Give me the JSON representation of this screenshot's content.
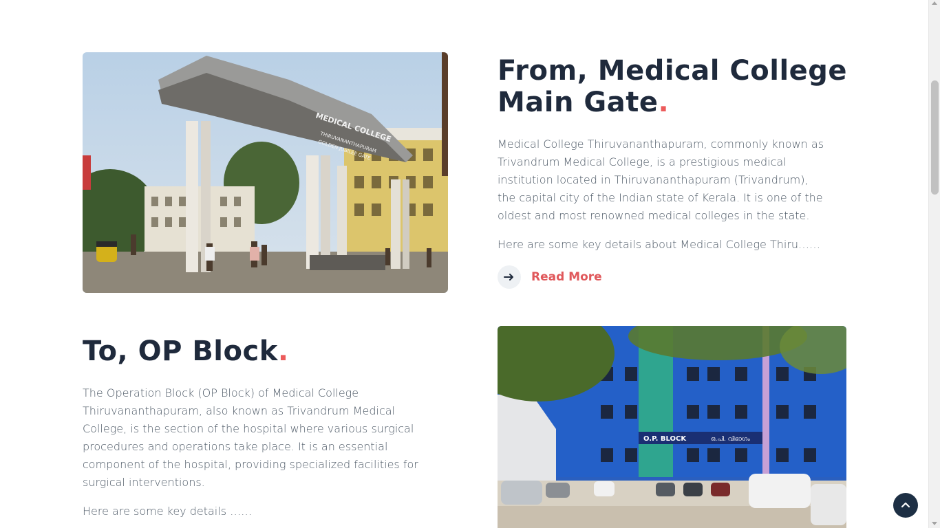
{
  "section_gate": {
    "title": "From, Medical College Main Gate",
    "title_dot": ".",
    "image_alt": "Medical College main gate arch",
    "paragraph": "Medical College Thiruvananthapuram, commonly known as Trivandrum Medical College, is a prestigious medical institution located in Thiruvananthapuram (Trivandrum), the capital city of the Indian state of Kerala. It is one of the oldest and most renowned medical colleges in the state.",
    "excerpt": "Here are some key details about Medical College Thiru……",
    "read_more_label": "Read More",
    "sign_text_1": "MEDICAL COLLEGE",
    "sign_text_2": "THIRUVANANTHAPURAM",
    "sign_text_3": "GOLDEN JUBILEE GATE"
  },
  "section_op": {
    "title": "To, OP Block",
    "title_dot": ".",
    "image_alt": "O.P. Block building",
    "paragraph": "The Operation Block (OP Block) of Medical College Thiruvananthapuram, also known as Trivandrum Medical College, is the section of the hospital where various surgical procedures and operations take place. It is an essential component of the hospital, providing specialized facilities for surgical interventions.",
    "excerpt": "Here are some key details ……",
    "sign_text_en": "O.P. BLOCK",
    "sign_text_ml": "ഒ.പി. വിഭാഗം"
  },
  "colors": {
    "accent": "#ec5b5b",
    "heading": "#1f2a3c",
    "body_text": "#4d5966",
    "back_to_top_bg": "#1d2f44"
  },
  "icons": {
    "read_more": "arrow-right-icon",
    "back_to_top": "chevron-up-icon"
  }
}
